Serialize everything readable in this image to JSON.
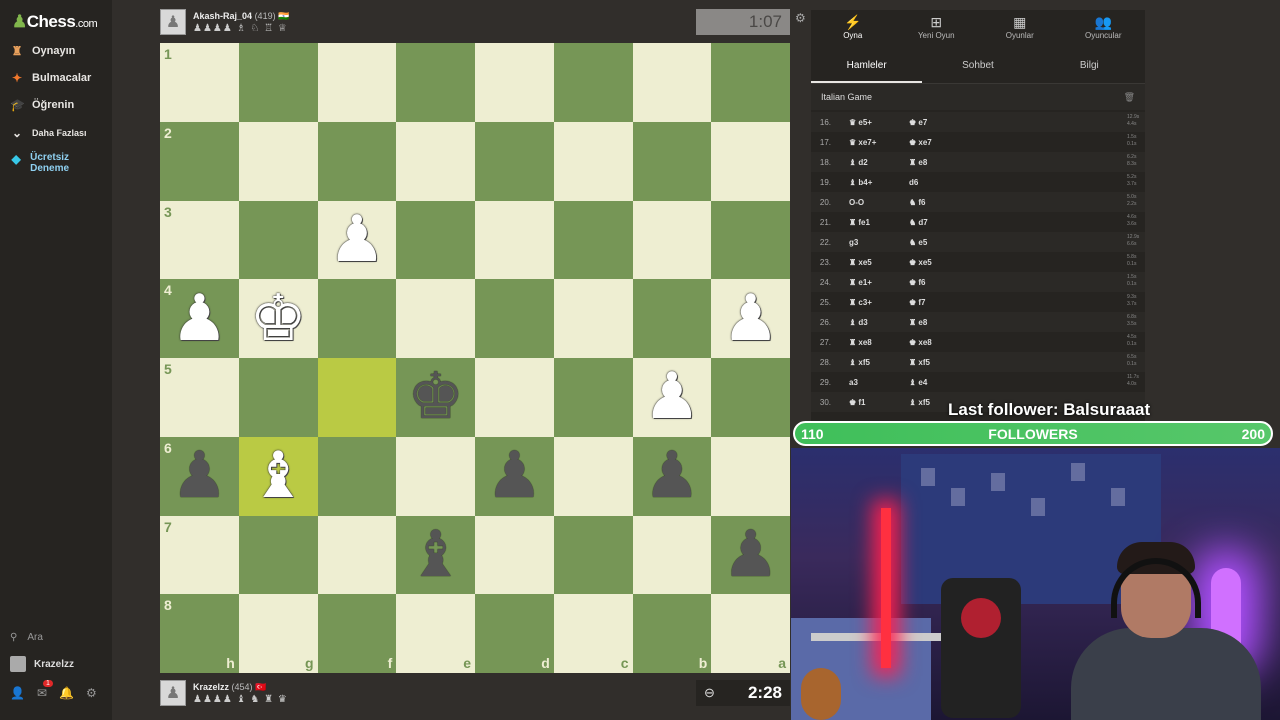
{
  "logo": {
    "pawn": "♟",
    "text": "Chess",
    "domain": ".com"
  },
  "nav": {
    "play": {
      "label": "Oynayın",
      "icon": "♜"
    },
    "puzzles": {
      "label": "Bulmacalar",
      "icon": "✦"
    },
    "learn": {
      "label": "Öğrenin",
      "icon": "🎓"
    },
    "more": {
      "label": "Daha Fazlası",
      "icon": "⌄"
    },
    "trial": {
      "label": "Ücretsiz Deneme",
      "icon": "◆"
    },
    "search": {
      "label": "Ara",
      "icon": "⚲"
    },
    "user": {
      "label": "Krazelzz"
    },
    "badge": "1"
  },
  "top_player": {
    "name": "Akash-Raj_04",
    "rating": "(419)",
    "flag": "🇮🇳",
    "captured": "♟♟♟♟ ♗ ♘ ♖ ♕",
    "clock": "1:07",
    "avatar_icon": "♟"
  },
  "bottom_player": {
    "name": "Krazelzz",
    "rating": "(454)",
    "flag": "🇹🇷",
    "captured": "♟♟♟♟ ♝ ♞ ♜ ♛",
    "clock": "2:28",
    "avatar_icon": "♟",
    "clock_icon": "⊖"
  },
  "board": {
    "ranks": [
      "1",
      "2",
      "3",
      "4",
      "5",
      "6",
      "7",
      "8"
    ],
    "files": [
      "h",
      "g",
      "f",
      "e",
      "d",
      "c",
      "b",
      "a"
    ],
    "highlight": [
      "4-2",
      "5-1"
    ],
    "pieces": {
      "2-2": [
        "w",
        "♟"
      ],
      "3-0": [
        "w",
        "♟"
      ],
      "3-1": [
        "w",
        "♚"
      ],
      "3-7": [
        "w",
        "♟"
      ],
      "4-3": [
        "b",
        "♚"
      ],
      "4-6": [
        "w",
        "♟"
      ],
      "5-0": [
        "b",
        "♟"
      ],
      "5-1": [
        "w",
        "♝"
      ],
      "5-4": [
        "b",
        "♟"
      ],
      "5-6": [
        "b",
        "♟"
      ],
      "6-3": [
        "b",
        "♝"
      ],
      "6-7": [
        "b",
        "♟"
      ]
    }
  },
  "panel": {
    "tabs": [
      {
        "label": "Oyna",
        "icon": "⚡"
      },
      {
        "label": "Yeni Oyun",
        "icon": "⊞"
      },
      {
        "label": "Oyunlar",
        "icon": "▦"
      },
      {
        "label": "Oyuncular",
        "icon": "👥"
      }
    ],
    "subtabs": [
      "Hamleler",
      "Sohbet",
      "Bilgi"
    ],
    "opening": "Italian Game",
    "moves": [
      {
        "n": "16.",
        "w": "♛ e5+",
        "b": "♚ e7",
        "t1": "12.9s",
        "t2": "4.4s",
        "f1": 0.75,
        "f2": 0.3
      },
      {
        "n": "17.",
        "w": "♛ xe7+",
        "b": "♚ xe7",
        "t1": "1.5s",
        "t2": "0.1s",
        "f1": 0.1,
        "f2": 0.05
      },
      {
        "n": "18.",
        "w": "♝ d2",
        "b": "♜ e8",
        "t1": "6.2s",
        "t2": "8.3s",
        "f1": 0.35,
        "f2": 0.45
      },
      {
        "n": "19.",
        "w": "♝ b4+",
        "b": "d6",
        "t1": "5.2s",
        "t2": "3.7s",
        "f1": 0.3,
        "f2": 0.2
      },
      {
        "n": "20.",
        "w": "O-O",
        "b": "♞ f6",
        "t1": "5.0s",
        "t2": "2.2s",
        "f1": 0.28,
        "f2": 0.12
      },
      {
        "n": "21.",
        "w": "♜ fe1",
        "b": "♞ d7",
        "t1": "4.6s",
        "t2": "3.6s",
        "f1": 0.25,
        "f2": 0.2
      },
      {
        "n": "22.",
        "w": "g3",
        "b": "♞ e5",
        "t1": "12.9s",
        "t2": "6.6s",
        "f1": 0.75,
        "f2": 0.38
      },
      {
        "n": "23.",
        "w": "♜ xe5",
        "b": "♚ xe5",
        "t1": "5.8s",
        "t2": "0.1s",
        "f1": 0.32,
        "f2": 0.05
      },
      {
        "n": "24.",
        "w": "♜ e1+",
        "b": "♚ f6",
        "t1": "1.5s",
        "t2": "0.1s",
        "f1": 0.1,
        "f2": 0.05
      },
      {
        "n": "25.",
        "w": "♜ c3+",
        "b": "♚ f7",
        "t1": "9.3s",
        "t2": "3.7s",
        "f1": 0.55,
        "f2": 0.2
      },
      {
        "n": "26.",
        "w": "♝ d3",
        "b": "♜ e8",
        "t1": "6.8s",
        "t2": "3.5s",
        "f1": 0.38,
        "f2": 0.2
      },
      {
        "n": "27.",
        "w": "♜ xe8",
        "b": "♚ xe8",
        "t1": "4.5s",
        "t2": "0.1s",
        "f1": 0.25,
        "f2": 0.05
      },
      {
        "n": "28.",
        "w": "♝ xf5",
        "b": "♜ xf5",
        "t1": "6.5s",
        "t2": "0.1s",
        "f1": 0.36,
        "f2": 0.05
      },
      {
        "n": "29.",
        "w": "a3",
        "b": "♝ e4",
        "t1": "11.7s",
        "t2": "4.0s",
        "f1": 0.68,
        "f2": 0.22
      },
      {
        "n": "30.",
        "w": "♚ f1",
        "b": "♝ xf5",
        "t1": "",
        "t2": "",
        "f1": 0,
        "f2": 0
      }
    ]
  },
  "overlay": {
    "follower_text": "Last follower: Balsuraaat",
    "current": "110",
    "label": "FOLLOWERS",
    "goal": "200"
  }
}
